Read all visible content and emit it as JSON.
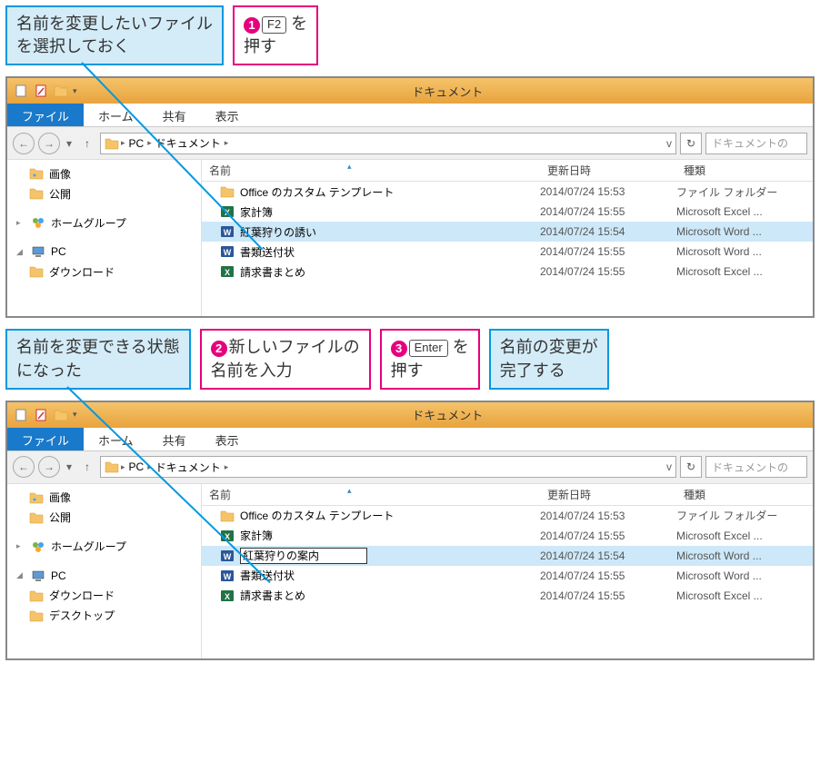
{
  "callouts": {
    "row1": {
      "select_file": "名前を変更したいファイル\nを選択しておく",
      "step1_key": "F2",
      "step1_text": " を\n押す"
    },
    "row2": {
      "editable": "名前を変更できる状態\nになった",
      "step2": "新しいファイルの\n名前を入力",
      "step3_key": "Enter",
      "step3_text": " を\n押す",
      "done": "名前の変更が\n完了する"
    }
  },
  "explorer": {
    "title": "ドキュメント",
    "tabs": {
      "file": "ファイル",
      "home": "ホーム",
      "share": "共有",
      "view": "表示"
    },
    "breadcrumb": {
      "pc": "PC",
      "docs": "ドキュメント"
    },
    "search_placeholder": "ドキュメントの",
    "columns": {
      "name": "名前",
      "date": "更新日時",
      "type": "種類"
    },
    "dropdown_combo": "v"
  },
  "sidebar": {
    "images": "画像",
    "public": "公開",
    "homegroup": "ホームグループ",
    "pc": "PC",
    "downloads": "ダウンロード",
    "desktop": "デスクトップ"
  },
  "files1": [
    {
      "name": "Office のカスタム テンプレート",
      "date": "2014/07/24 15:53",
      "type": "ファイル フォルダー",
      "icon": "folder"
    },
    {
      "name": "家計簿",
      "date": "2014/07/24 15:55",
      "type": "Microsoft Excel ...",
      "icon": "excel"
    },
    {
      "name": "紅葉狩りの誘い",
      "date": "2014/07/24 15:54",
      "type": "Microsoft Word ...",
      "icon": "word",
      "selected": true
    },
    {
      "name": "書類送付状",
      "date": "2014/07/24 15:55",
      "type": "Microsoft Word ...",
      "icon": "word"
    },
    {
      "name": "請求書まとめ",
      "date": "2014/07/24 15:55",
      "type": "Microsoft Excel ...",
      "icon": "excel"
    }
  ],
  "files2": [
    {
      "name": "Office のカスタム テンプレート",
      "date": "2014/07/24 15:53",
      "type": "ファイル フォルダー",
      "icon": "folder"
    },
    {
      "name": "家計簿",
      "date": "2014/07/24 15:55",
      "type": "Microsoft Excel ...",
      "icon": "excel"
    },
    {
      "name": "紅葉狩りの案内",
      "date": "2014/07/24 15:54",
      "type": "Microsoft Word ...",
      "icon": "word",
      "selected": true,
      "editing": true
    },
    {
      "name": "書類送付状",
      "date": "2014/07/24 15:55",
      "type": "Microsoft Word ...",
      "icon": "word"
    },
    {
      "name": "請求書まとめ",
      "date": "2014/07/24 15:55",
      "type": "Microsoft Excel ...",
      "icon": "excel"
    }
  ]
}
